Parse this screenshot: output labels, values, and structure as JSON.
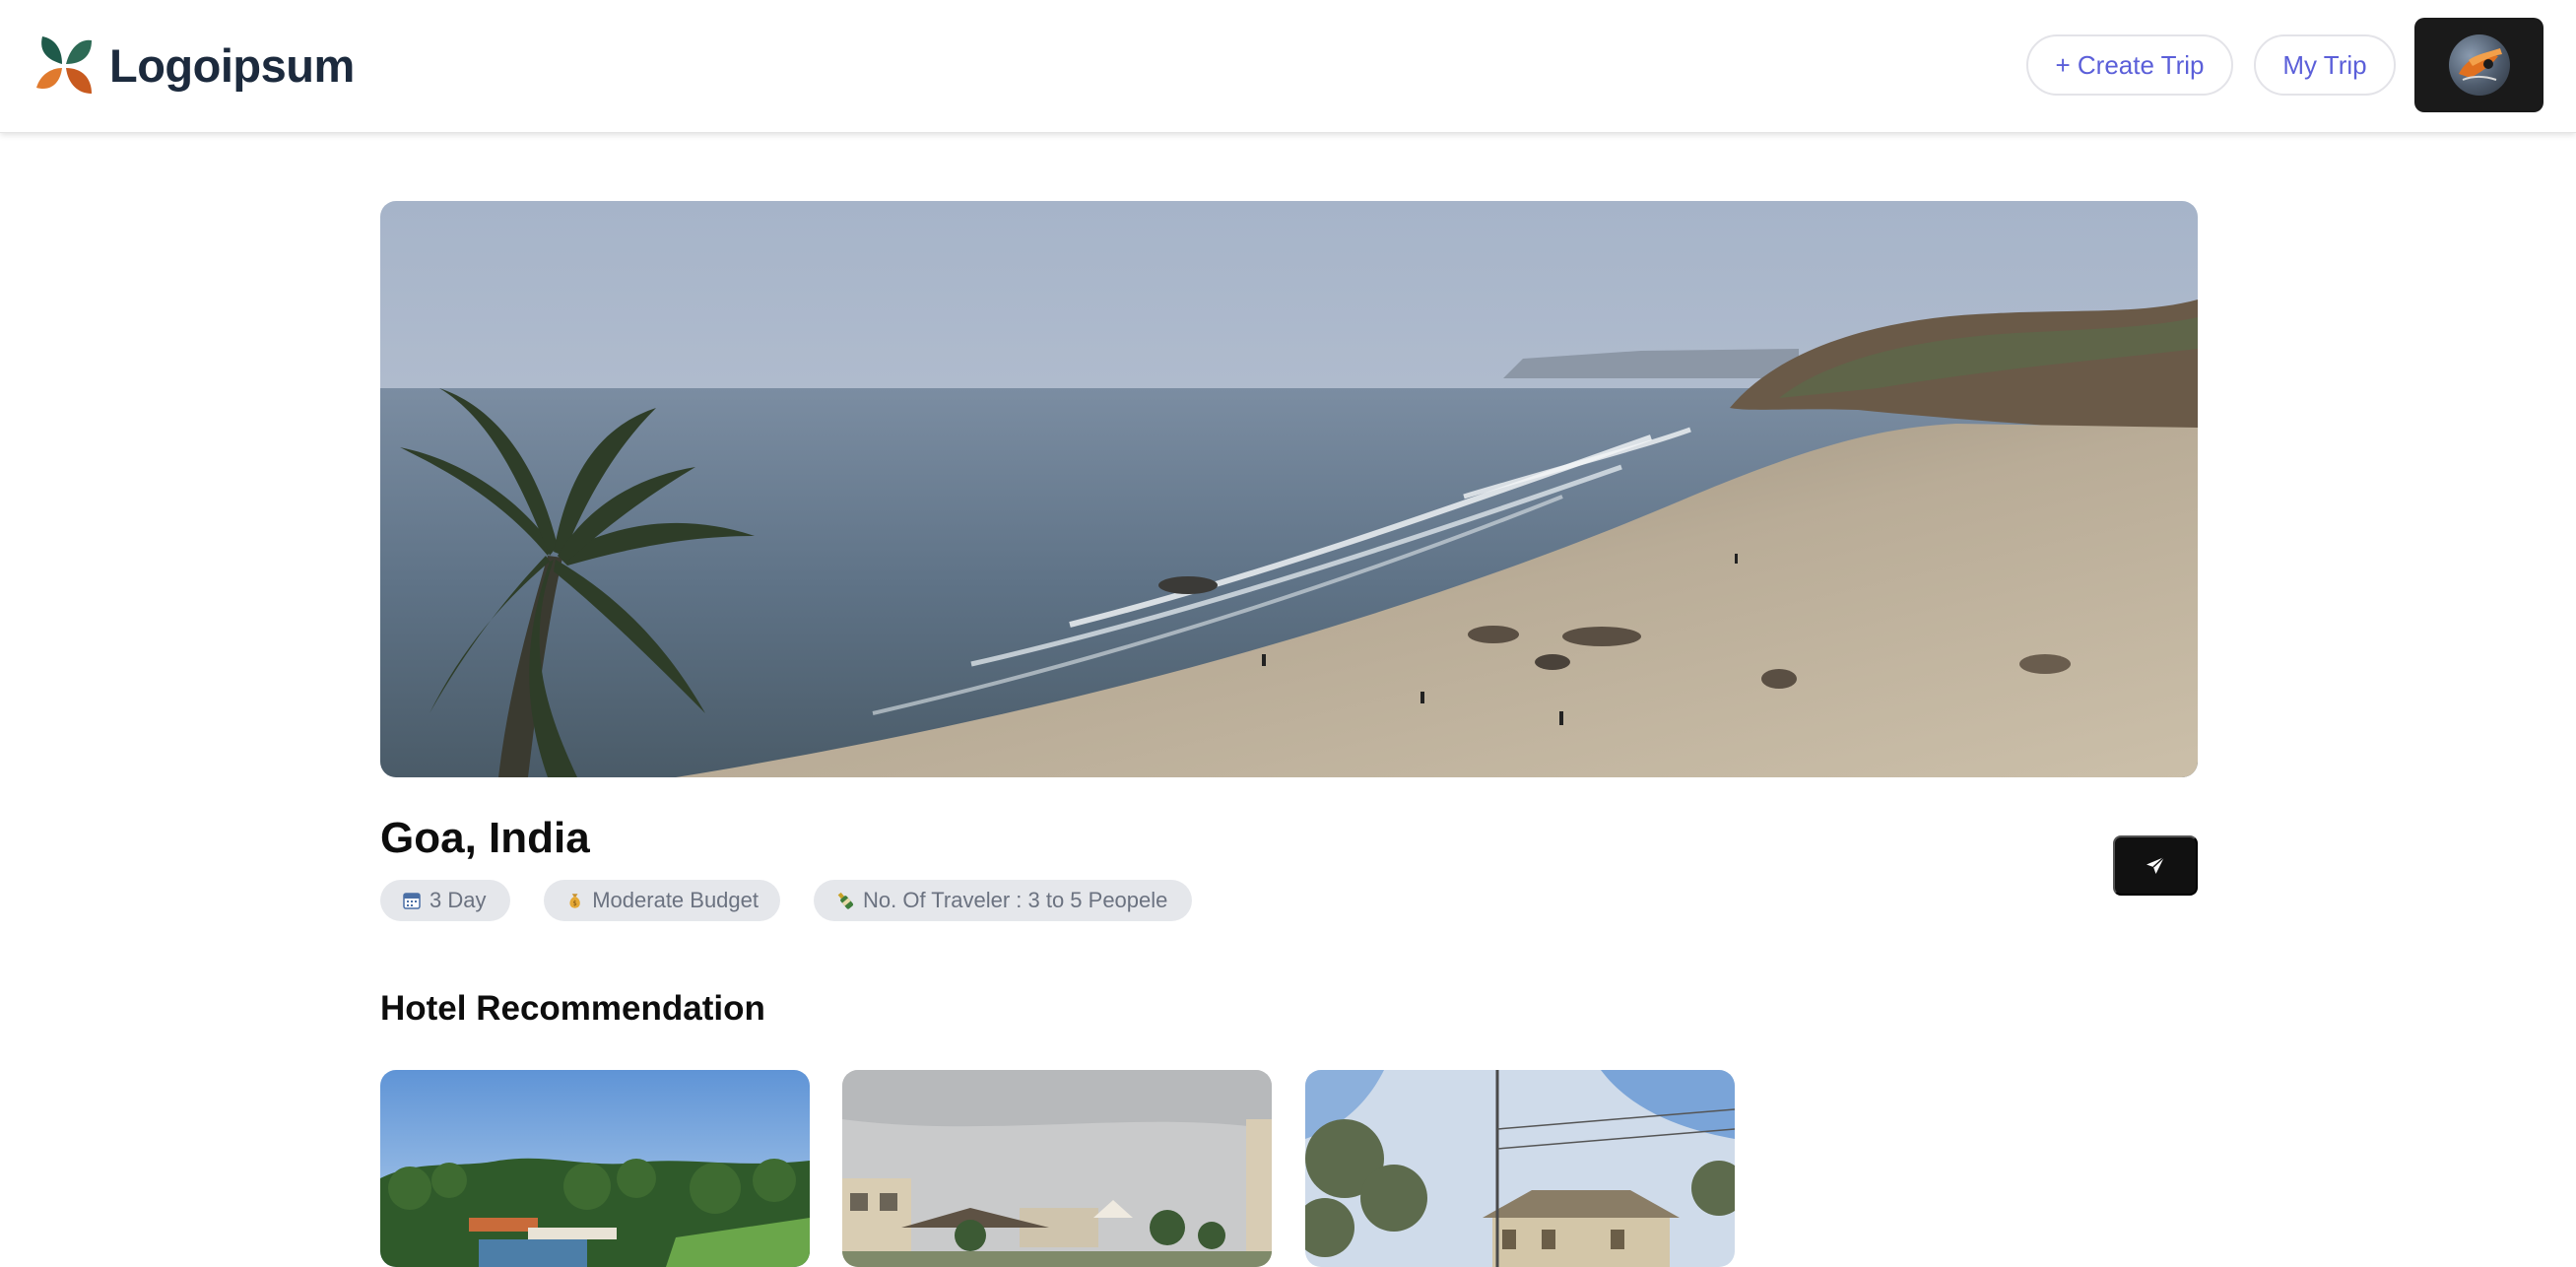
{
  "header": {
    "logo_text": "Logoipsum",
    "create_trip_label": "+ Create Trip",
    "my_trip_label": "My Trip"
  },
  "trip": {
    "title": "Goa, India",
    "chips": {
      "days": "3 Day",
      "budget": "Moderate Budget",
      "travelers": "No. Of Traveler : 3 to 5 Peopele"
    },
    "chip_icons": {
      "days": "calendar-icon",
      "budget": "money-bag-icon",
      "travelers": "bottle-icon"
    }
  },
  "hotels": {
    "section_title": "Hotel Recommendation"
  },
  "colors": {
    "accent": "#5b5fd9",
    "dark": "#111111",
    "chip_bg": "#e5e7eb",
    "chip_text": "#6b7280"
  }
}
